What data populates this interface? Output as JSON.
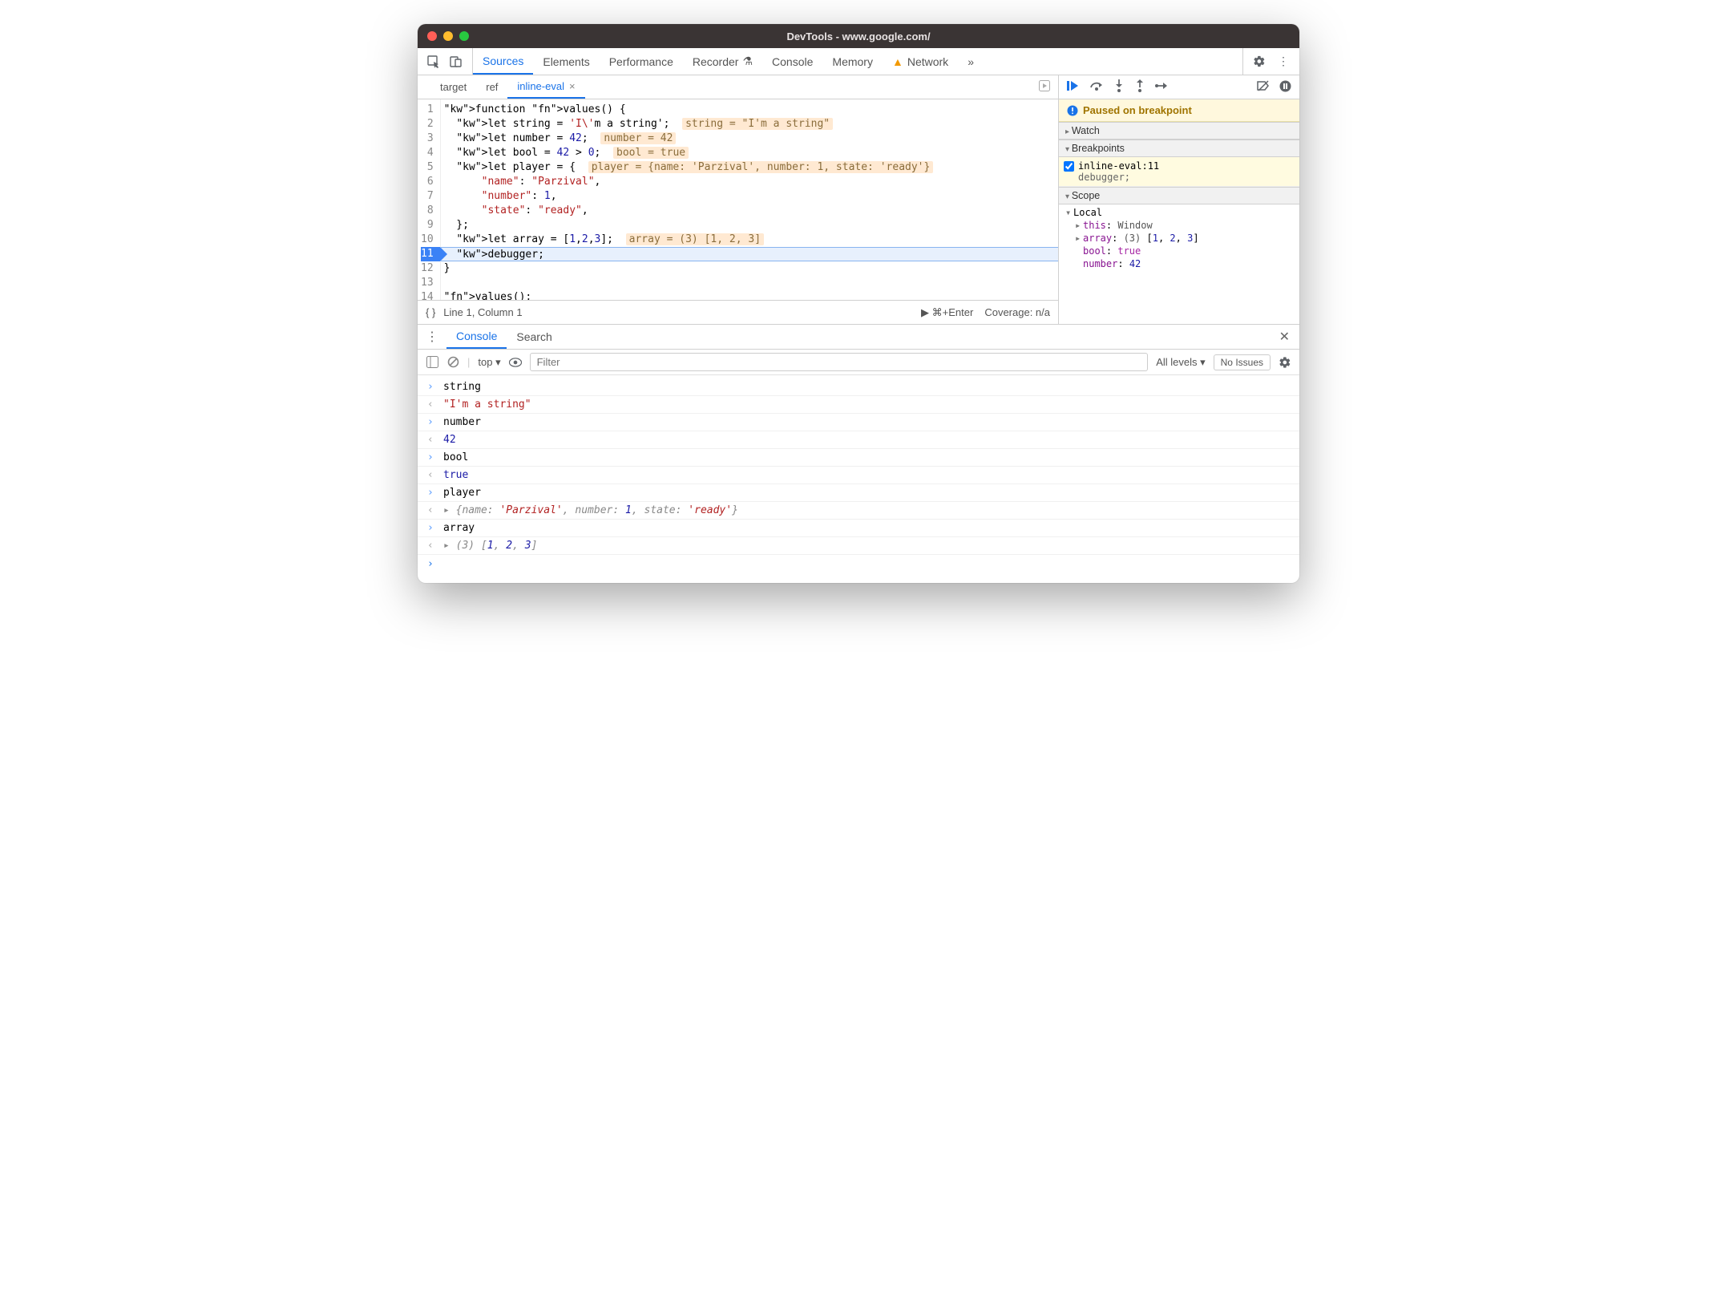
{
  "window": {
    "title": "DevTools - www.google.com/"
  },
  "tabs": {
    "items": [
      "Sources",
      "Elements",
      "Performance",
      "Recorder",
      "Console",
      "Memory",
      "Network"
    ],
    "warning_on": "Network",
    "active": "Sources"
  },
  "file_tabs": {
    "items": [
      "target",
      "ref",
      "inline-eval"
    ],
    "active": "inline-eval"
  },
  "code": {
    "lines": [
      {
        "n": 1,
        "plain": "function values() {"
      },
      {
        "n": 2,
        "plain": "  let string = 'I\\'m a string';",
        "inline": "string = \"I'm a string\""
      },
      {
        "n": 3,
        "plain": "  let number = 42;",
        "inline": "number = 42"
      },
      {
        "n": 4,
        "plain": "  let bool = 42 > 0;",
        "inline": "bool = true"
      },
      {
        "n": 5,
        "plain": "  let player = {",
        "inline": "player = {name: 'Parzival', number: 1, state: 'ready'}"
      },
      {
        "n": 6,
        "plain": "      \"name\": \"Parzival\","
      },
      {
        "n": 7,
        "plain": "      \"number\": 1,"
      },
      {
        "n": 8,
        "plain": "      \"state\": \"ready\","
      },
      {
        "n": 9,
        "plain": "  };"
      },
      {
        "n": 10,
        "plain": "  let array = [1,2,3];",
        "inline": "array = (3) [1, 2, 3]"
      },
      {
        "n": 11,
        "plain": "  debugger;",
        "bp": true,
        "paused": true
      },
      {
        "n": 12,
        "plain": "}"
      },
      {
        "n": 13,
        "plain": ""
      },
      {
        "n": 14,
        "plain": "values();"
      }
    ]
  },
  "status_bar": {
    "pos": "Line 1, Column 1",
    "shortcut": "⌘+Enter",
    "coverage": "Coverage: n/a"
  },
  "debugger": {
    "paused_msg": "Paused on breakpoint",
    "sections": {
      "watch": "Watch",
      "breakpoints": "Breakpoints",
      "scope": "Scope"
    },
    "breakpoint": {
      "label": "inline-eval:11",
      "snippet": "debugger;"
    },
    "scope_local": "Local",
    "scope_items": [
      {
        "expand": true,
        "name": "this",
        "sep": ": ",
        "val": "Window",
        "cls": "vtype"
      },
      {
        "expand": true,
        "name": "array",
        "sep": ": ",
        "val": "(3) [1, 2, 3]",
        "cls": "vtype",
        "arr": true
      },
      {
        "expand": false,
        "name": "bool",
        "sep": ": ",
        "val": "true",
        "cls": "vbool"
      },
      {
        "expand": false,
        "name": "number",
        "sep": ": ",
        "val": "42",
        "cls": "vnum"
      }
    ]
  },
  "drawer": {
    "tabs": [
      "Console",
      "Search"
    ],
    "active": "Console"
  },
  "console_toolbar": {
    "context": "top",
    "filter_placeholder": "Filter",
    "levels": "All levels",
    "issues": "No Issues"
  },
  "console": [
    {
      "dir": "in",
      "text": "string"
    },
    {
      "dir": "out",
      "type": "str",
      "text": "\"I'm a string\""
    },
    {
      "dir": "in",
      "text": "number"
    },
    {
      "dir": "out",
      "type": "num",
      "text": "42"
    },
    {
      "dir": "in",
      "text": "bool"
    },
    {
      "dir": "out",
      "type": "bool",
      "text": "true"
    },
    {
      "dir": "in",
      "text": "player"
    },
    {
      "dir": "out",
      "type": "obj",
      "text": "{name: 'Parzival', number: 1, state: 'ready'}"
    },
    {
      "dir": "in",
      "text": "array"
    },
    {
      "dir": "out",
      "type": "arr",
      "text": "(3) [1, 2, 3]"
    }
  ]
}
